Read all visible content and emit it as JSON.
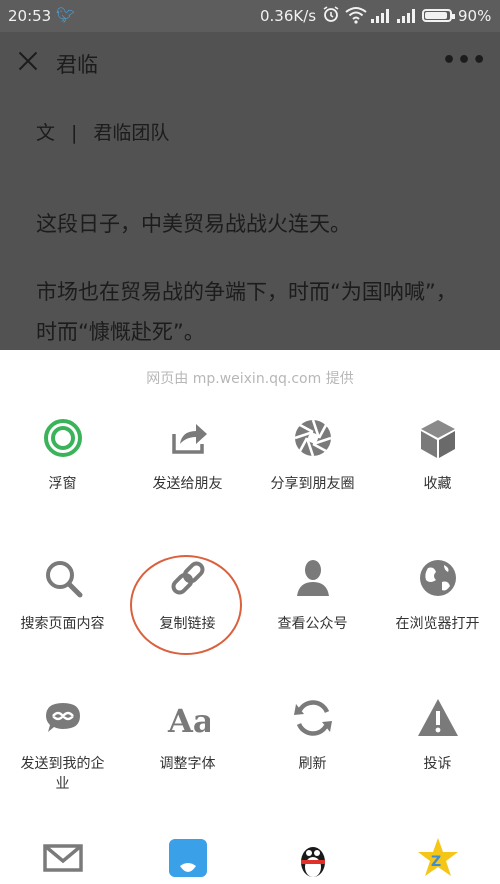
{
  "status": {
    "time": "20:53",
    "net_speed": "0.36K/s",
    "battery": "90%",
    "battery_level": 0.9
  },
  "article": {
    "title": "君临",
    "more": "•••",
    "author_prefix": "文",
    "author_sep": "|",
    "author": "君临团队",
    "paragraphs": [
      "这段日子，中美贸易战战火连天。",
      "市场也在贸易战的争端下，时而“为国呐喊”，时而“慷慨赴死”。"
    ]
  },
  "sheet": {
    "provider": "网页由 mp.weixin.qq.com 提供",
    "items": [
      {
        "label": "浮窗",
        "icon": "floating-window-icon"
      },
      {
        "label": "发送给朋友",
        "icon": "share-arrow-icon"
      },
      {
        "label": "分享到朋友圈",
        "icon": "moments-aperture-icon"
      },
      {
        "label": "收藏",
        "icon": "favorite-cube-icon"
      },
      {
        "label": "搜索页面内容",
        "icon": "search-icon"
      },
      {
        "label": "复制链接",
        "icon": "link-icon"
      },
      {
        "label": "查看公众号",
        "icon": "person-icon"
      },
      {
        "label": "在浏览器打开",
        "icon": "globe-icon"
      },
      {
        "label": "发送到我的企业",
        "icon": "enterprise-icon"
      },
      {
        "label": "调整字体",
        "icon": "font-icon"
      },
      {
        "label": "刷新",
        "icon": "refresh-icon"
      },
      {
        "label": "投诉",
        "icon": "warning-icon"
      },
      {
        "label": "",
        "icon": "mail-icon"
      },
      {
        "label": "",
        "icon": "notebook-icon"
      },
      {
        "label": "",
        "icon": "qq-penguin-icon"
      },
      {
        "label": "",
        "icon": "qzone-star-icon"
      }
    ]
  },
  "colors": {
    "accent_green": "#3bb35a",
    "icon_gray": "#7a7a7a",
    "highlight_red": "#d9613e",
    "dim_overlay": "#525252"
  }
}
